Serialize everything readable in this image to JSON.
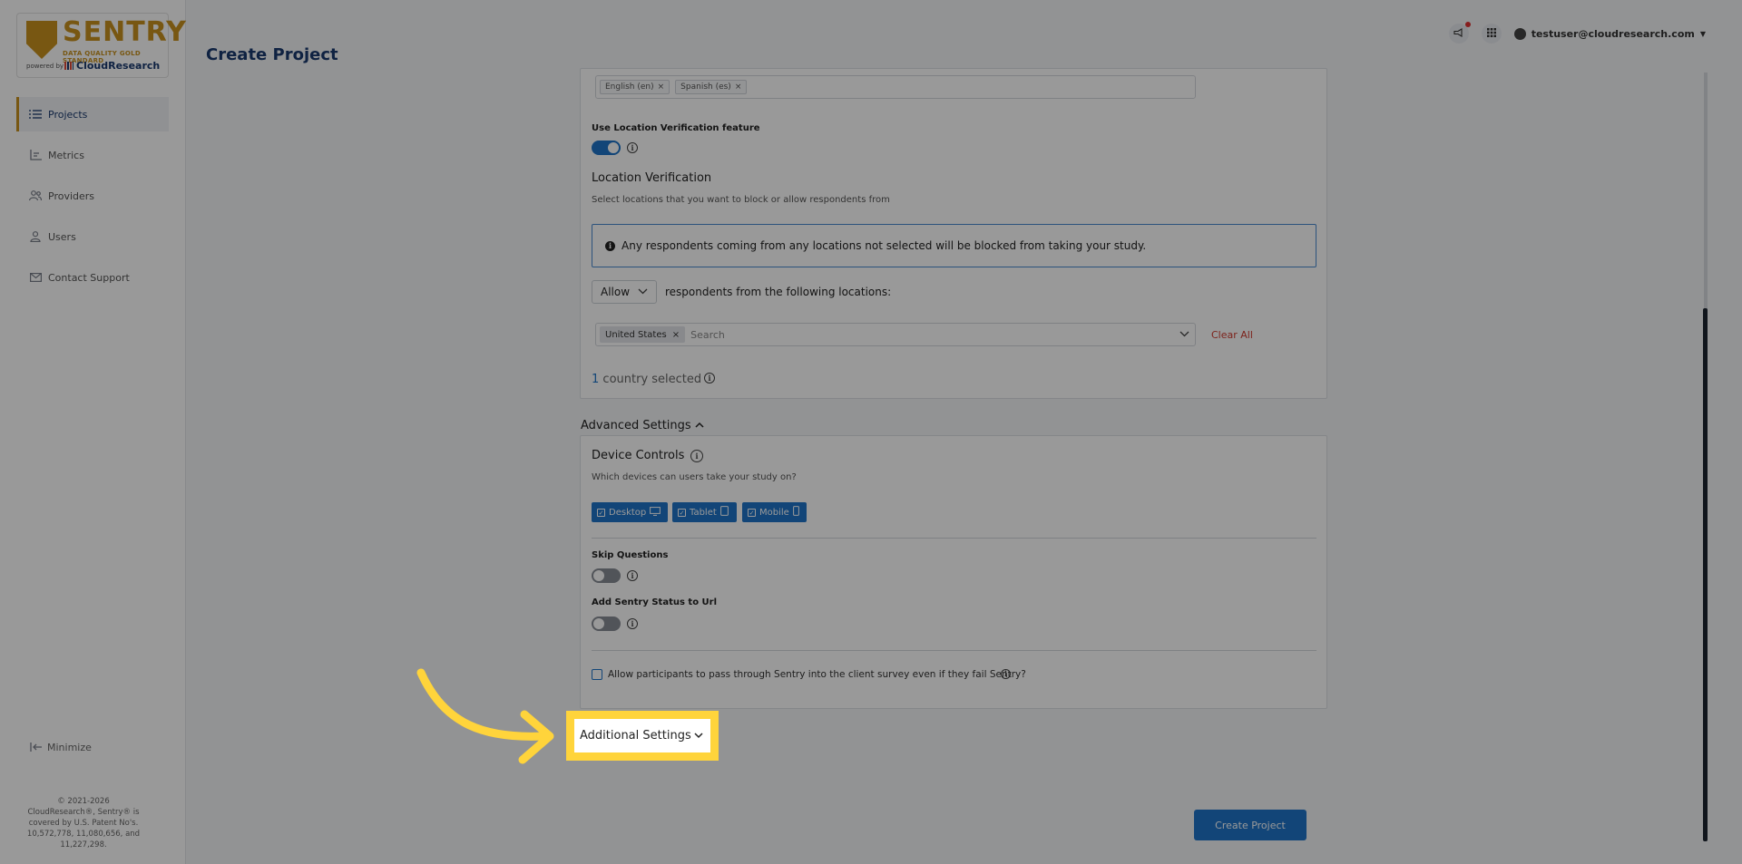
{
  "sidebar": {
    "logo_text": "SENTRY",
    "logo_sub": "DATA QUALITY GOLD STANDARD",
    "powered_by": "powered by",
    "cloudresearch": "CloudResearch",
    "items": [
      {
        "label": "Projects",
        "icon": "list-icon",
        "active": true
      },
      {
        "label": "Metrics",
        "icon": "bar-chart-icon"
      },
      {
        "label": "Providers",
        "icon": "people-icon"
      },
      {
        "label": "Users",
        "icon": "user-icon"
      },
      {
        "label": "Contact Support",
        "icon": "mail-icon"
      }
    ],
    "minimize": "Minimize",
    "copyright": "© 2021-2026 CloudResearch®, Sentry® is covered by U.S. Patent No's. 10,572,778, 11,080,656, and 11,227,298."
  },
  "header": {
    "title": "Create Project",
    "user_email": "testuser@cloudresearch.com"
  },
  "languages": {
    "chips": [
      "English (en)",
      "Spanish (es)"
    ]
  },
  "location": {
    "toggle_label": "Use Location Verification feature",
    "heading": "Location Verification",
    "help": "Select locations that you want to block or allow respondents from",
    "alert": "Any respondents coming from any locations not selected will be blocked from taking your study.",
    "mode": "Allow",
    "mode_suffix": "respondents from the following locations:",
    "selected_chip": "United States",
    "search_placeholder": "Search",
    "clear_all": "Clear All",
    "count": "1",
    "count_suffix": "country selected"
  },
  "advanced": {
    "link": "Advanced Settings",
    "device_heading": "Device Controls",
    "device_help": "Which devices can users take your study on?",
    "devices": [
      "Desktop",
      "Tablet",
      "Mobile"
    ],
    "skip_questions": "Skip Questions",
    "add_status": "Add Sentry Status to Url",
    "pass_through": "Allow participants to pass through Sentry into the client survey even if they fail Sentry?"
  },
  "additional": {
    "link": "Additional Settings"
  },
  "footer": {
    "create_button": "Create Project"
  },
  "colors": {
    "primary": "#1e74c8",
    "brand_gold": "#c8921f",
    "title_navy": "#1a3a6e",
    "highlight": "#ffd43b",
    "danger": "#d13b2f"
  }
}
